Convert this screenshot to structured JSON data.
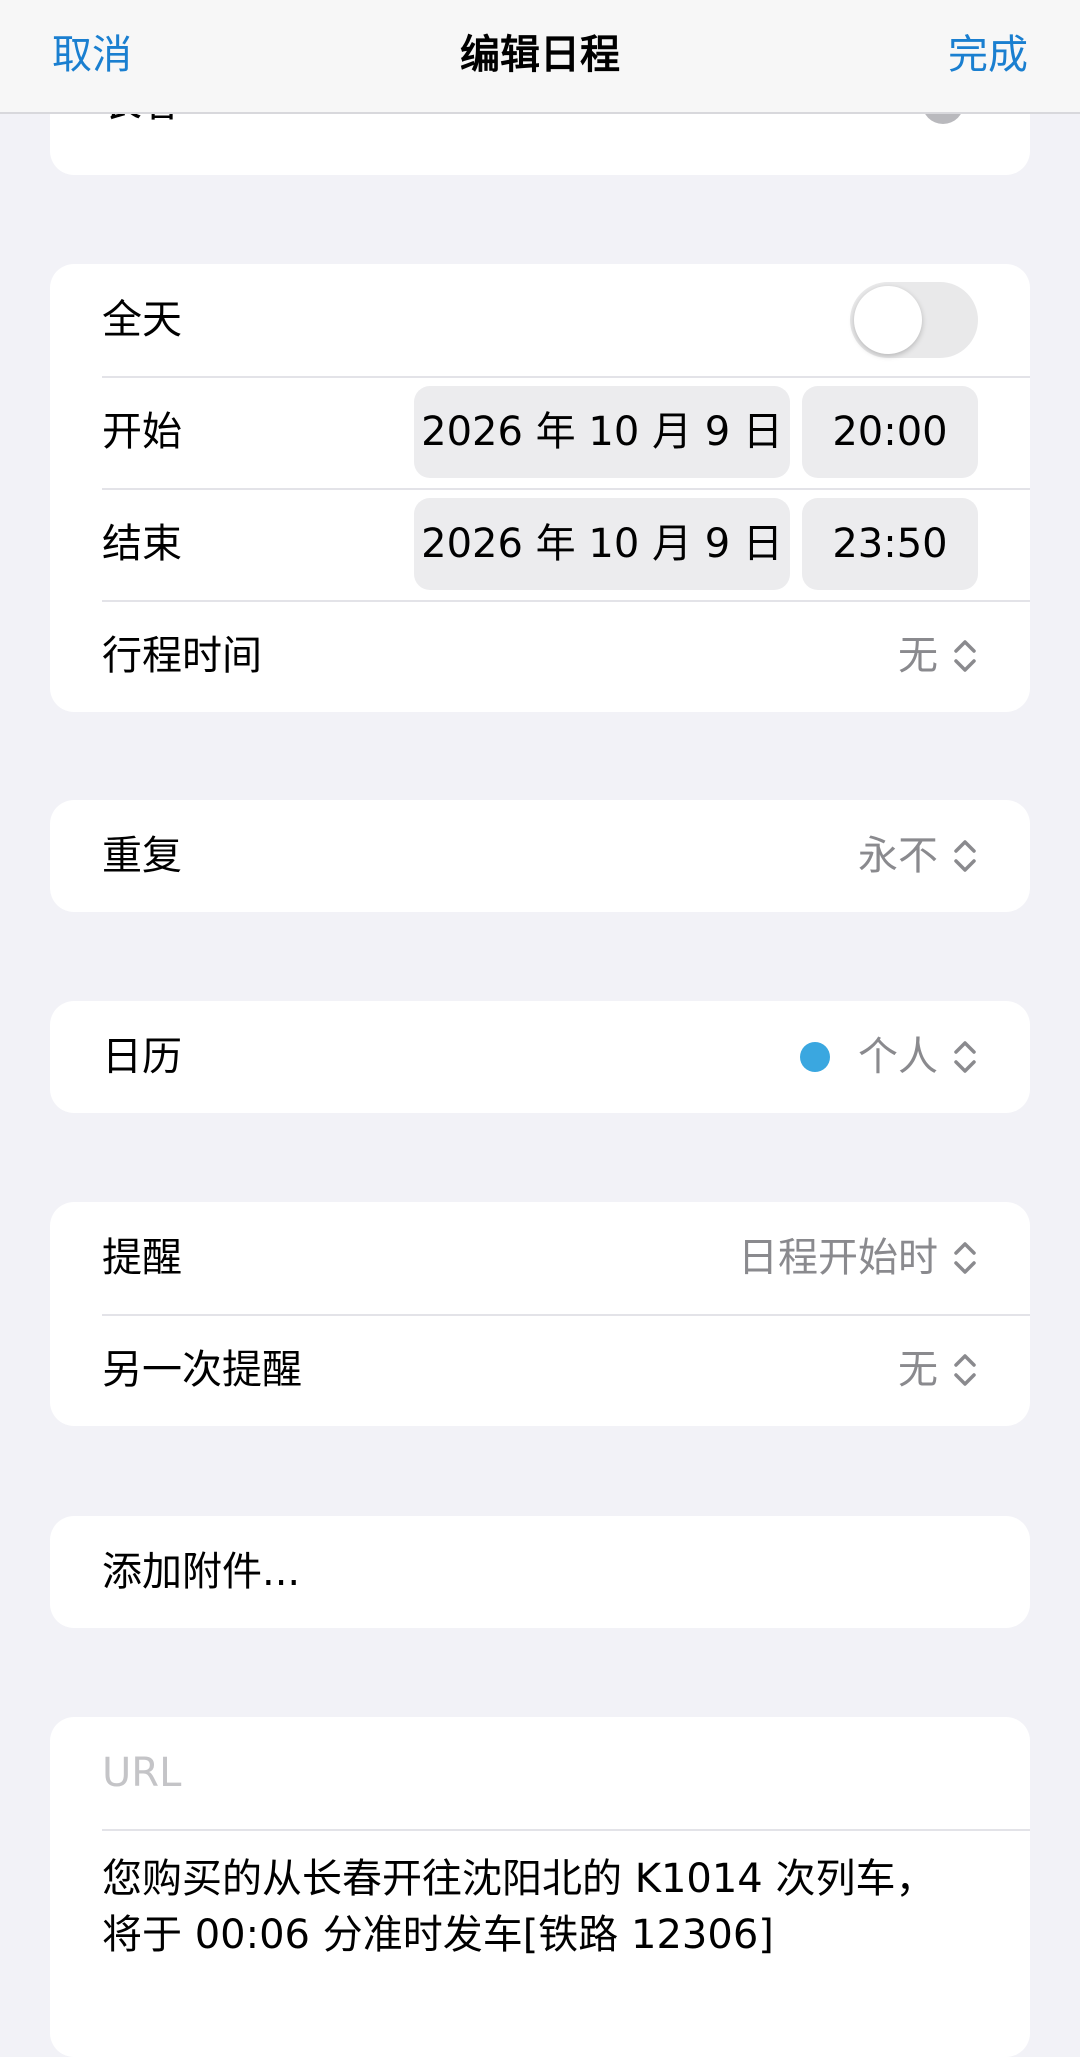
{
  "navbar": {
    "cancel_label": "取消",
    "title": "编辑日程",
    "done_label": "完成"
  },
  "event": {
    "title": "长春"
  },
  "time_section": {
    "all_day_label": "全天",
    "all_day_on": false,
    "start_label": "开始",
    "start_date": "2026 年 10 月 9 日",
    "start_time": "20:00",
    "end_label": "结束",
    "end_date": "2026 年 10 月 9 日",
    "end_time": "23:50",
    "travel_label": "行程时间",
    "travel_value": "无"
  },
  "repeat": {
    "label": "重复",
    "value": "永不"
  },
  "calendar": {
    "label": "日历",
    "value": "个人",
    "dot_color": "#3aa7e0"
  },
  "alerts": {
    "alert_label": "提醒",
    "alert_value": "日程开始时",
    "second_label": "另一次提醒",
    "second_value": "无"
  },
  "attachment": {
    "label": "添加附件..."
  },
  "notes_section": {
    "url_placeholder": "URL",
    "notes_line1": "您购买的从长春开往沈阳北的 K1014 次列车，",
    "notes_line2": "将于 00:06 分准时发车[铁路 12306]"
  },
  "colors": {
    "accent": "#1a7fd0",
    "background": "#f2f2f7"
  },
  "icons": {
    "clear": "clear-circle-icon",
    "chevron": "chevron-up-down-icon"
  }
}
